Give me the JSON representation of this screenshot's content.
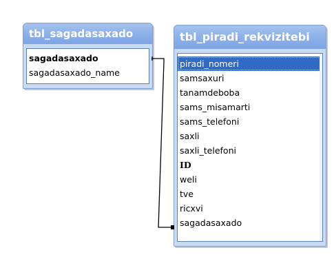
{
  "tables": [
    {
      "title": "tbl_sagadasaxado",
      "fields": [
        {
          "name": "sagadasaxado",
          "key": true
        },
        {
          "name": "sagadasaxado_name",
          "key": false
        }
      ]
    },
    {
      "title": "tbl_piradi_rekvizitebi",
      "fields": [
        {
          "name": "piradi_nomeri",
          "selected": true
        },
        {
          "name": "samsaxuri"
        },
        {
          "name": "tanamdeboba"
        },
        {
          "name": "sams_misamarti"
        },
        {
          "name": "sams_telefoni"
        },
        {
          "name": "saxli"
        },
        {
          "name": "saxli_telefoni"
        },
        {
          "name": "ID",
          "bold": true
        },
        {
          "name": "weli"
        },
        {
          "name": "tve"
        },
        {
          "name": "ricxvi"
        },
        {
          "name": "sagadasaxado"
        }
      ]
    }
  ],
  "relationship": {
    "from": "tbl_sagadasaxado.sagadasaxado",
    "to": "tbl_piradi_rekvizitebi.sagadasaxado",
    "color": "#000000"
  },
  "colors": {
    "title_bar": "#8fb2ea",
    "window_frame": "#c9daf4",
    "selection": "#316ac5"
  }
}
